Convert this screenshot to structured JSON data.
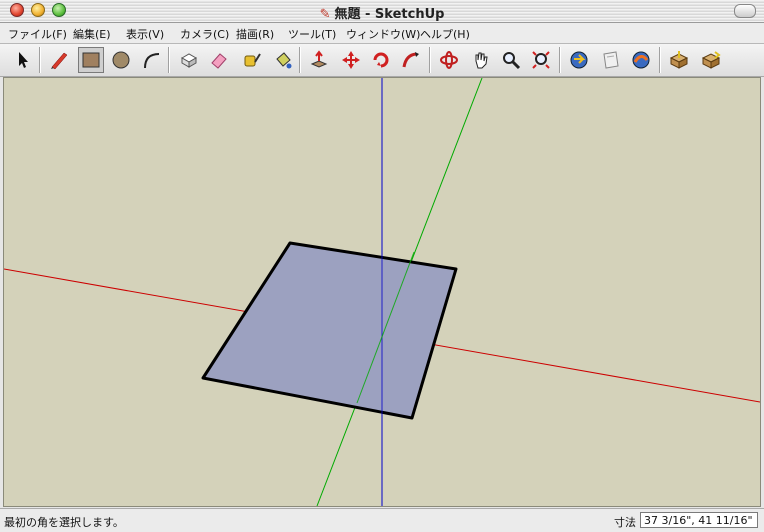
{
  "window": {
    "title": "無題 - SketchUp",
    "title_icon": "pencil-icon"
  },
  "menu": {
    "items": [
      {
        "label": "ファイル(F)"
      },
      {
        "label": "編集(E)"
      },
      {
        "label": "表示(V)"
      },
      {
        "label": "カメラ(C)"
      },
      {
        "label": "描画(R)"
      },
      {
        "label": "ツール(T)"
      },
      {
        "label": "ウィンドウ(W)"
      },
      {
        "label": "ヘルプ(H)"
      }
    ]
  },
  "toolbar": {
    "tools": [
      {
        "icon": "select-arrow-icon"
      },
      {
        "icon": "pencil-line-icon"
      },
      {
        "icon": "rectangle-icon",
        "active": true
      },
      {
        "icon": "circle-icon"
      },
      {
        "icon": "arc-icon"
      },
      {
        "icon": "make-component-icon"
      },
      {
        "icon": "eraser-icon"
      },
      {
        "icon": "tape-measure-icon"
      },
      {
        "icon": "paint-bucket-icon"
      },
      {
        "icon": "push-pull-icon"
      },
      {
        "icon": "move-icon"
      },
      {
        "icon": "rotate-icon"
      },
      {
        "icon": "follow-me-icon"
      },
      {
        "icon": "orbit-icon"
      },
      {
        "icon": "pan-hand-icon"
      },
      {
        "icon": "zoom-icon"
      },
      {
        "icon": "zoom-extents-icon"
      },
      {
        "icon": "previous-view-icon"
      },
      {
        "icon": "next-view-icon"
      },
      {
        "icon": "walkthrough-icon"
      },
      {
        "icon": "get-models-icon"
      },
      {
        "icon": "share-model-icon"
      }
    ]
  },
  "colors": {
    "viewport_bg": "#d4d2ba",
    "axis_red": "#cc0000",
    "axis_green": "#00aa00",
    "axis_blue": "#0000cc",
    "face_fill": "#9ca1c0",
    "edge": "#000000"
  },
  "status": {
    "message": "最初の角を選択します。",
    "measure_label": "寸法",
    "measure_value": "37 3/16\", 41 11/16\""
  }
}
